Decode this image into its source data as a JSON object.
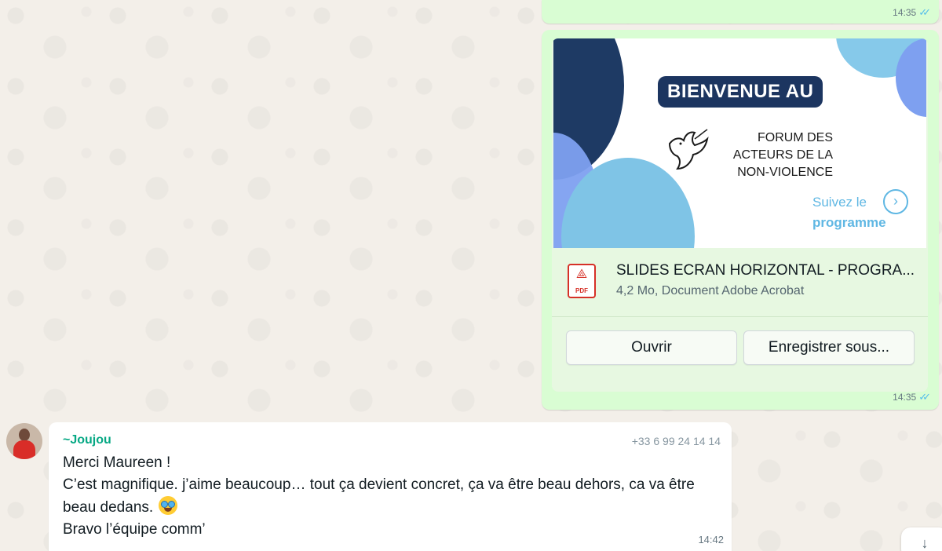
{
  "top_message": {
    "time": "14:35",
    "status_icon": "double-check-read"
  },
  "document_message": {
    "preview": {
      "banner_text": "BIENVENUE AU",
      "forum_line1": "FORUM DES",
      "forum_line2": "ACTEURS DE LA",
      "forum_line3": "NON-VIOLENCE",
      "suivez_line1": "Suivez le",
      "suivez_line2": "programme"
    },
    "file_icon_label": "PDF",
    "file_name": "SLIDES ECRAN HORIZONTAL - PROGRA...",
    "file_meta": "4,2 Mo, Document Adobe Acrobat",
    "open_label": "Ouvrir",
    "save_label": "Enregistrer sous...",
    "time": "14:35",
    "status_icon": "double-check-read"
  },
  "incoming_message": {
    "sender": "~Joujou",
    "phone": "+33 6 99 24 14 14",
    "line1": "Merci Maureen !",
    "line2": "C’est magnifique. j’aime beaucoup… tout ça devient concret, ça va être beau dehors, ca va être beau dedans.",
    "line3": "Bravo l’équipe comm’",
    "emoji": "star-struck",
    "time": "14:42"
  },
  "colors": {
    "outgoing_bubble": "#d9fdd3",
    "incoming_bubble": "#ffffff",
    "sender_name": "#06a884",
    "read_ticks": "#53bdeb",
    "pdf_red": "#d63027"
  }
}
